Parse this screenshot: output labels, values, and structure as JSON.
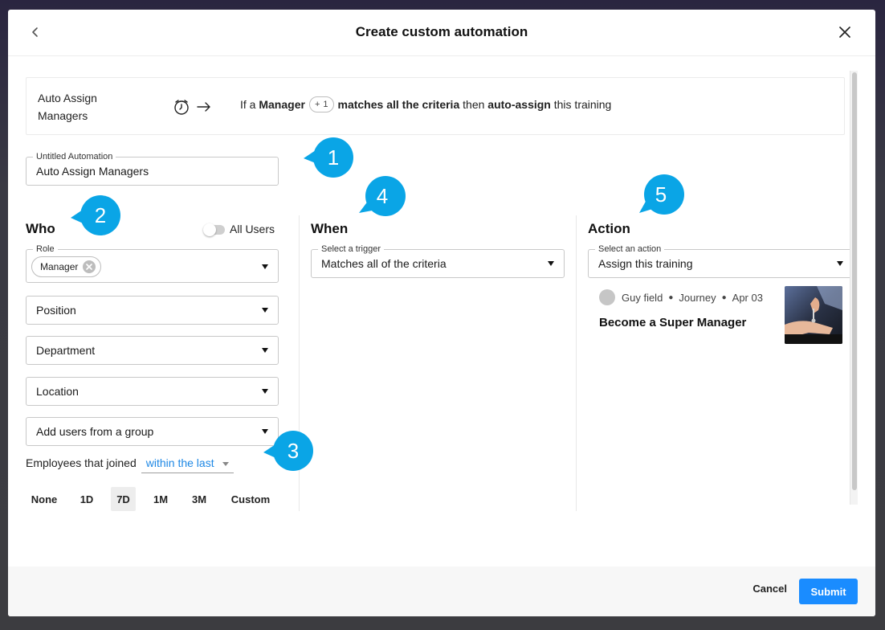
{
  "header": {
    "title": "Create custom automation"
  },
  "summary": {
    "name": "Auto Assign Managers",
    "prefix": "If a",
    "role": "Manager",
    "plus_count": "1",
    "criteria": "matches all the criteria",
    "then": "then",
    "action": "auto-assign",
    "suffix": "this training"
  },
  "automation_name": {
    "label": "Untitled Automation",
    "value": "Auto Assign Managers"
  },
  "who": {
    "title": "Who",
    "all_users_label": "All Users",
    "role_label": "Role",
    "role_chip": "Manager",
    "position_placeholder": "Position",
    "department_placeholder": "Department",
    "location_placeholder": "Location",
    "group_placeholder": "Add users from a group",
    "joined_label": "Employees that joined",
    "joined_value": "within the last",
    "ranges": [
      "None",
      "1D",
      "7D",
      "1M",
      "3M",
      "Custom"
    ],
    "active_range": "7D"
  },
  "when": {
    "title": "When",
    "trigger_label": "Select a trigger",
    "trigger_value": "Matches all of the criteria"
  },
  "action": {
    "title": "Action",
    "action_label": "Select an action",
    "action_value": "Assign this training",
    "training": {
      "author": "Guy field",
      "type": "Journey",
      "date": "Apr 03",
      "title": "Become a Super Manager"
    }
  },
  "callouts": [
    "1",
    "2",
    "3",
    "4",
    "5"
  ],
  "footer": {
    "cancel_label": "Cancel",
    "submit_label": "Submit"
  },
  "colors": {
    "accent": "#1a8cff",
    "callout": "#0aa5e6",
    "link": "#1e88e5"
  }
}
